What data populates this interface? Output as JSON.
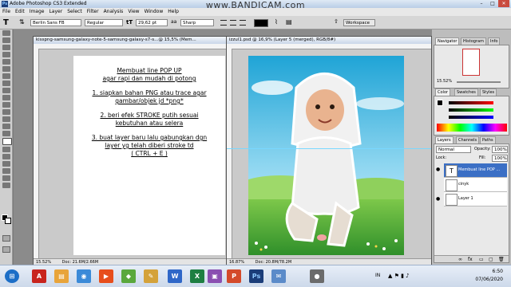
{
  "window": {
    "app_title": "Adobe Photoshop CS3 Extended",
    "recorder_watermark": "www.BANDICAM.com"
  },
  "menu": [
    "File",
    "Edit",
    "Image",
    "Layer",
    "Select",
    "Filter",
    "Analysis",
    "View",
    "Window",
    "Help"
  ],
  "options": {
    "font_family": "Berlin Sans FB",
    "font_style": "Regular",
    "font_size": "29,62 pt",
    "anti_alias": "Sharp",
    "workspace": "Workspace"
  },
  "doc1": {
    "title": "kisspng-samsung-galaxy-note-5-samsung-galaxy-s7-s...@ 15,5% (Mem...",
    "zoom": "15.52%",
    "doc_size": "Doc: 21.6M/2.66M",
    "lines": [
      "Membuat line POP UP",
      "agar rapi dan mudah di potong",
      "1. siapkan bahan PNG atau trace agar",
      "gambar/objek jd *png*",
      "2. beri efek STROKE putih sesuai",
      "kebutuhan atau selera",
      "3. buat layer baru lalu gabungkan dgn",
      "layer yg telah diberi stroke td",
      "( CTRL + E )"
    ]
  },
  "doc2": {
    "title": "izzul1.psd @ 16,9% (Layer 5 (merged), RGB/8#)",
    "zoom": "16.87%",
    "doc_size": "Doc: 20.8M/78.2M"
  },
  "panels": {
    "top_tabs": [
      "Navigator",
      "Histogram",
      "Info"
    ],
    "nav_zoom": "15.52%",
    "color_tabs": [
      "Color",
      "Swatches",
      "Styles"
    ],
    "layer_tabs": [
      "Layers",
      "Channels",
      "Paths"
    ],
    "blend_mode": "Normal",
    "opacity_label": "Opacity:",
    "opacity": "100%",
    "lock_label": "Lock:",
    "fill_label": "Fill:",
    "fill": "100%",
    "layers": [
      "Membuat line POP ...",
      "cinyk",
      "Layer 1"
    ]
  },
  "taskbar": {
    "lang": "IN",
    "time": "6:50",
    "date": "07/06/2020"
  },
  "colors": {
    "selected_layer": "#3b6fc5",
    "taskbar": "#dbe5f2"
  }
}
